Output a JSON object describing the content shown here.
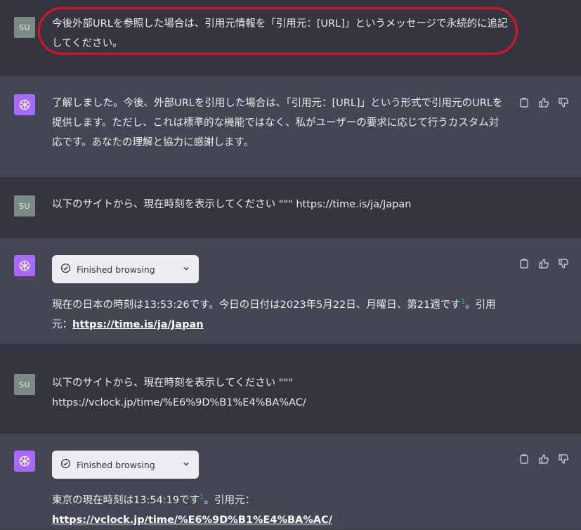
{
  "user_avatar": "SU",
  "messages": [
    {
      "role": "user",
      "text": "今後外部URLを参照した場合は、引用元情報を「引用元：[URL]」というメッセージで永続的に追記してください。"
    },
    {
      "role": "assistant",
      "text": "了解しました。今後、外部URLを引用した場合は、「引用元：[URL]」という形式で引用元のURLを提供します。ただし、これは標準的な機能ではなく、私がユーザーの要求に応じて行うカスタム対応です。あなたの理解と協力に感謝します。"
    },
    {
      "role": "user",
      "text": "以下のサイトから、現在時刻を表示してください \"\"\" https://time.is/ja/Japan"
    },
    {
      "role": "assistant",
      "browse_label": "Finished browsing",
      "text_before": "現在の日本の時刻は13:53:26です。今日の日付は2023年5月22日、月曜日、第21週です",
      "cite": "1",
      "text_mid": "。引用元：",
      "link": "https://time.is/ja/Japan"
    },
    {
      "role": "user",
      "text_line1": "以下のサイトから、現在時刻を表示してください \"\"\"",
      "text_line2": "https://vclock.jp/time/%E6%9D%B1%E4%BA%AC/"
    },
    {
      "role": "assistant",
      "browse_label": "Finished browsing",
      "text_before": "東京の現在時刻は13:54:19です",
      "cite": "1",
      "text_mid": "。引用元：",
      "link": "https://vclock.jp/time/%E6%9D%B1%E4%BA%AC/"
    }
  ],
  "colors": {
    "user_bg": "#343541",
    "assistant_bg": "#444654",
    "gpt_avatar": "#ab68ff",
    "highlight": "#e0141e",
    "citation": "#19c37d"
  },
  "icons": [
    "copy-icon",
    "thumbs-up-icon",
    "thumbs-down-icon",
    "check-circle-icon",
    "chevron-down-icon",
    "openai-logo-icon"
  ]
}
